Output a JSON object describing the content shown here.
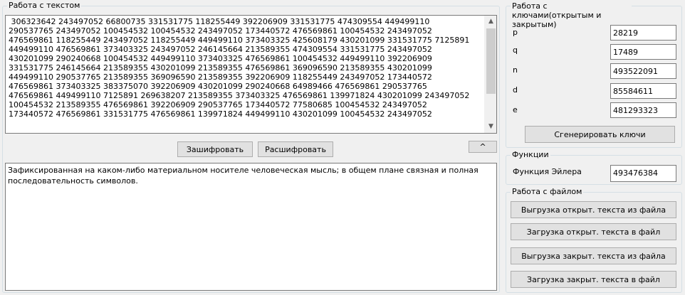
{
  "text_group": {
    "title": "Работа с текстом",
    "cipher_text": " 306323642 243497052 66800735 331531775 118255449 392206909 331531775 474309554 449499110\n290537765 243497052 100454532 100454532 243497052 173440572 476569861 100454532 243497052\n476569861 118255449 243497052 118255449 449499110 373403325 425608179 430201099 331531775 7125891\n449499110 476569861 373403325 243497052 246145664 213589355 474309554 331531775 243497052\n430201099 290240668 100454532 449499110 373403325 476569861 100454532 449499110 392206909\n331531775 246145664 213589355 430201099 213589355 476569861 369096590 213589355 430201099\n449499110 290537765 213589355 369096590 213589355 392206909 118255449 243497052 173440572\n476569861 373403325 383375070 392206909 430201099 290240668 64989466 476569861 290537765\n476569861 449499110 7125891 269638207 213589355 373403325 476569861 139971824 430201099 243497052\n100454532 213589355 476569861 392206909 290537765 173440572 77580685 100454532 243497052\n173440572 476569861 331531775 476569861 139971824 449499110 430201099 100454532 243497052",
    "encrypt_label": "Зашифровать",
    "decrypt_label": "Расшифровать",
    "collapse_label": "^",
    "plain_text": "Зафиксированная на каком-либо материальном носителе человеческая мысль; в общем плане связная и полная последовательность символов."
  },
  "keys_group": {
    "title": "Работа с ключами(открытым и закрытым)",
    "fields": [
      {
        "label": "p",
        "value": "28219"
      },
      {
        "label": "q",
        "value": "17489"
      },
      {
        "label": "n",
        "value": "493522091"
      },
      {
        "label": "d",
        "value": "85584611"
      },
      {
        "label": "e",
        "value": "481293323"
      }
    ],
    "generate_label": "Сгенерировать ключи"
  },
  "functions_group": {
    "title": "Функции",
    "euler_label": "Функция Эйлера",
    "euler_value": "493476384"
  },
  "file_group": {
    "title": "Работа с файлом",
    "buttons": [
      "Выгрузка открыт. текста из файла",
      "Загрузка открыт. текста в файл",
      "Выгрузка закрыт. текста из файла",
      "Загрузка закрыт. текста в файл"
    ]
  }
}
